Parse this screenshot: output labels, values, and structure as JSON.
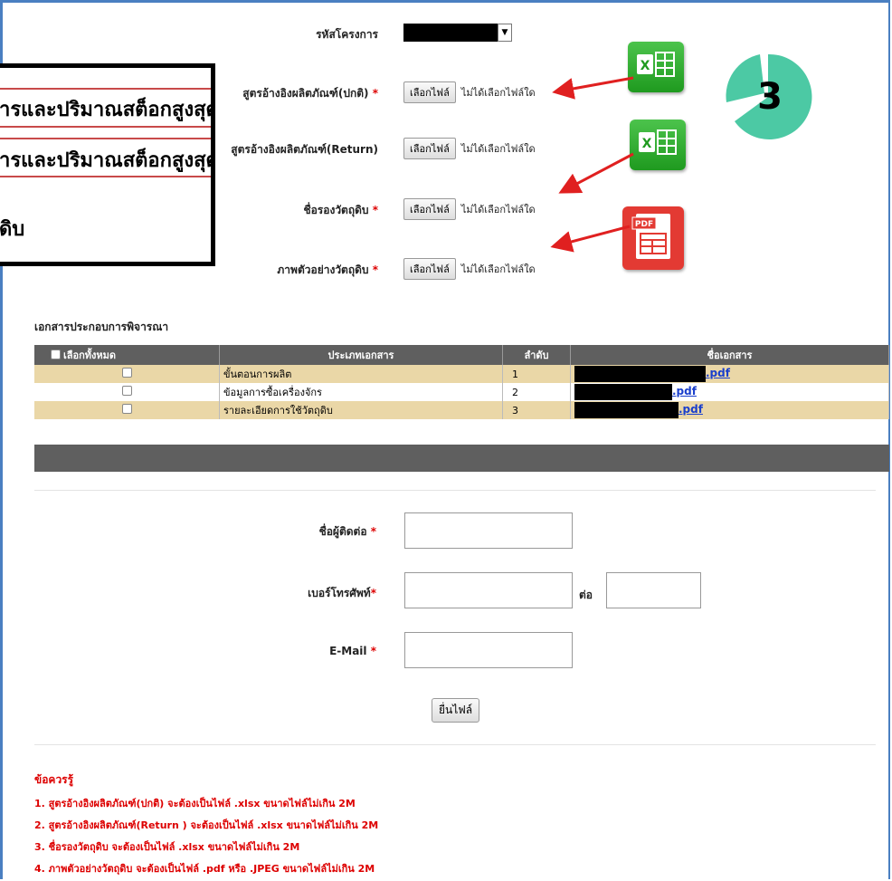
{
  "form": {
    "project_code_label": "รหัสโครงการ",
    "fields": [
      {
        "label": "สูตรอ้างอิงผลิตภัณฑ์(ปกติ)",
        "required": true
      },
      {
        "label": "สูตรอ้างอิงผลิตภัณฑ์(Return)",
        "required": false
      },
      {
        "label": "ชื่อรองวัตถุดิบ",
        "required": true
      },
      {
        "label": "ภาพตัวอย่างวัตถุดิบ",
        "required": true
      }
    ],
    "file_button_label": "เลือกไฟล์",
    "file_status": "ไม่ได้เลือกไฟล์ใด",
    "required_mark": "*"
  },
  "callout": {
    "lines": [
      "ารและปริมาณสต็อกสูงสุด",
      "ารและปริมาณสต็อกสูงสุด",
      "ดิบ"
    ]
  },
  "step_badge": {
    "number": "3",
    "color": "#4cc9a4"
  },
  "icons": {
    "excel_1": "excel-icon",
    "excel_2": "excel-icon",
    "pdf": "pdf-icon",
    "excel_glyph": "X",
    "pdf_glyph": "PDF"
  },
  "documents": {
    "heading": "เอกสารประกอบการพิจารณา",
    "columns": [
      "เลือกทั้งหมด",
      "ประเภทเอกสาร",
      "ลำดับ",
      "ชื่อเอกสาร"
    ],
    "rows": [
      {
        "type": "ขั้นตอนการผลิต",
        "order": "1",
        "file_suffix": ".pdf"
      },
      {
        "type": "ข้อมูลการซื้อเครื่องจักร",
        "order": "2",
        "file_suffix": ".pdf"
      },
      {
        "type": "รายละเอียดการใช้วัตถุดิบ",
        "order": "3",
        "file_suffix": ".pdf"
      }
    ]
  },
  "contact": {
    "name_label": "ชื่อผู้ติดต่อ",
    "phone_label": "เบอร์โทรศัพท์",
    "ext_label": "ต่อ",
    "email_label": "E-Mail",
    "required_mark": "*",
    "submit_label": "ยื่นไฟล์"
  },
  "notes": {
    "title": "ข้อควรรู้",
    "items": [
      "1. สูตรอ้างอิงผลิตภัณฑ์(ปกติ) จะต้องเป็นไฟล์ .xlsx ขนาดไฟล์ไม่เกิน 2M",
      "2. สูตรอ้างอิงผลิตภัณฑ์(Return ) จะต้องเป็นไฟล์ .xlsx ขนาดไฟล์ไม่เกิน 2M",
      "3. ชื่อรองวัตถุดิบ จะต้องเป็นไฟล์ .xlsx ขนาดไฟล์ไม่เกิน 2M",
      "4. ภาพตัวอย่างวัตถุดิบ จะต้องเป็นไฟล์ .pdf หรือ .JPEG ขนาดไฟล์ไม่เกิน 2M"
    ]
  },
  "colors": {
    "arrow": "#e02020",
    "row_highlight": "#ead7a7",
    "table_header": "#5f5f5f",
    "required": "#dd0000",
    "frame": "#4a7fc1"
  }
}
